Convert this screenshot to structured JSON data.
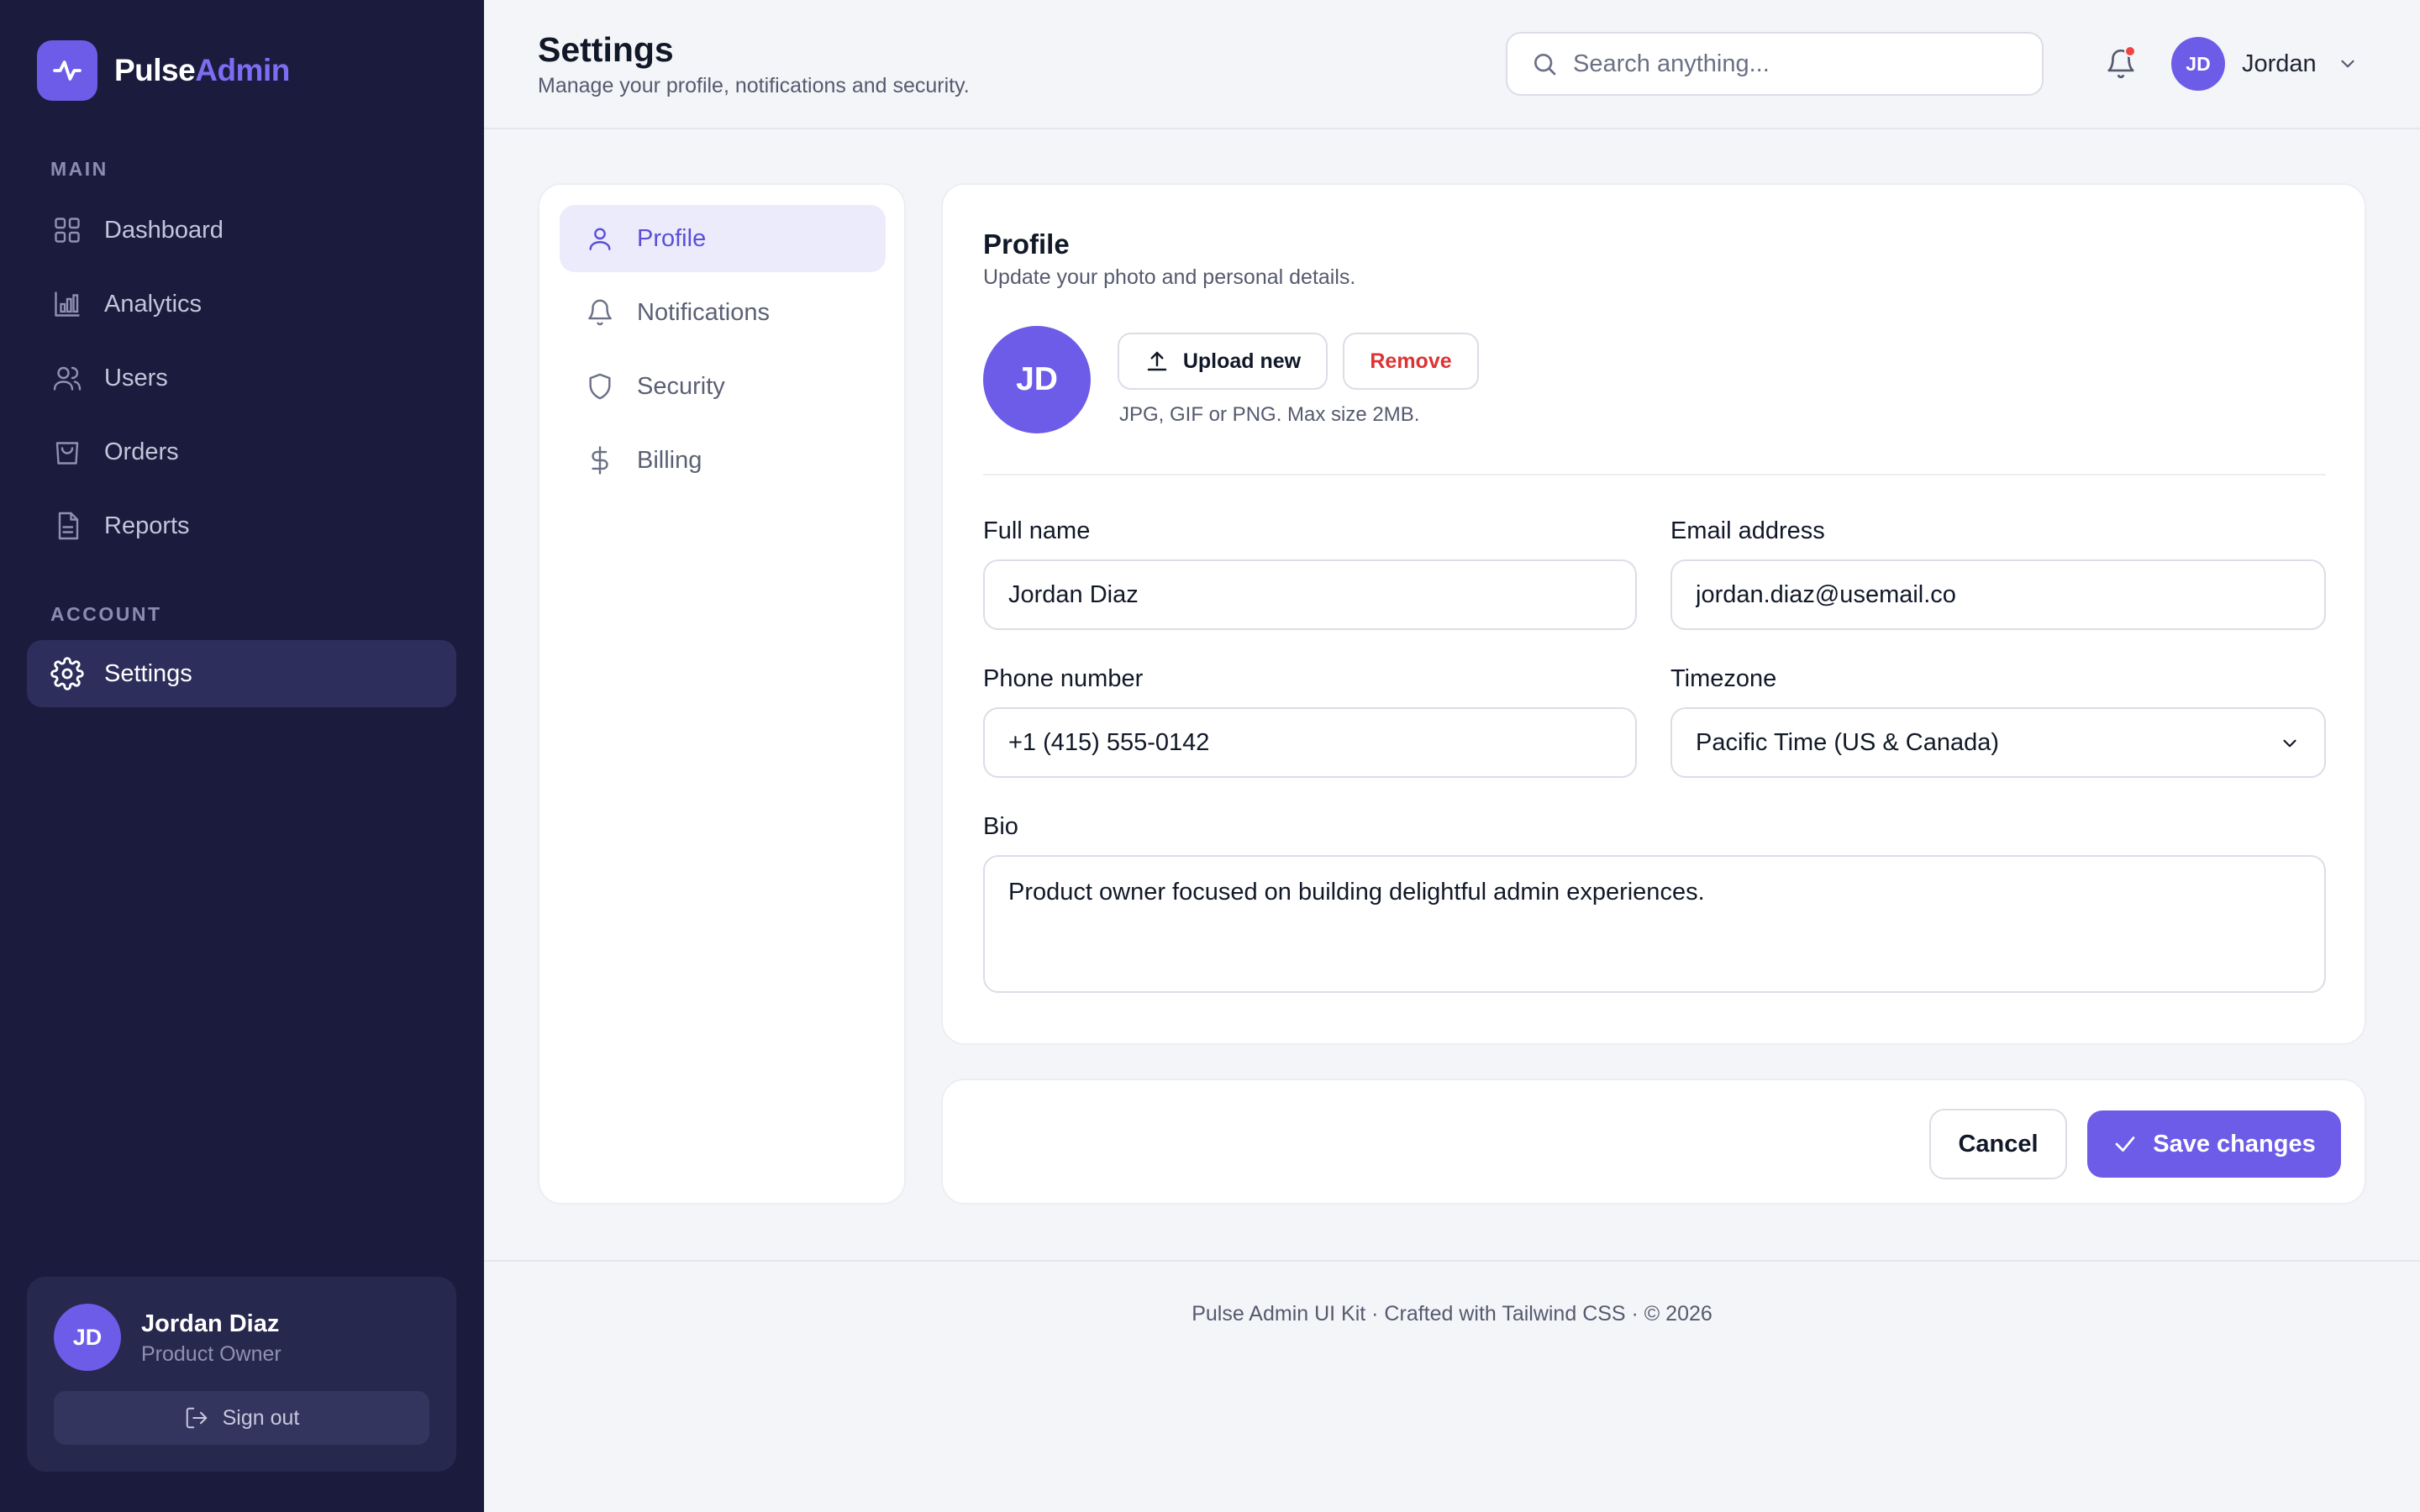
{
  "app": {
    "name_part1": "Pulse",
    "name_part2": "Admin"
  },
  "sidebar": {
    "sections": [
      "MAIN",
      "ACCOUNT"
    ],
    "items": [
      {
        "label": "Dashboard",
        "icon": "grid-icon"
      },
      {
        "label": "Analytics",
        "icon": "bar-chart-icon"
      },
      {
        "label": "Users",
        "icon": "users-icon"
      },
      {
        "label": "Orders",
        "icon": "shopping-bag-icon"
      },
      {
        "label": "Reports",
        "icon": "document-icon"
      },
      {
        "label": "Settings",
        "icon": "gear-icon",
        "active": true
      }
    ],
    "user": {
      "initials": "JD",
      "name": "Jordan Diaz",
      "role": "Product Owner",
      "signout": "Sign out"
    }
  },
  "header": {
    "title": "Settings",
    "subtitle": "Manage your profile, notifications and security.",
    "search_placeholder": "Search anything...",
    "user_initials": "JD",
    "user_name": "Jordan",
    "notification_dot_color": "#ef4444"
  },
  "settings_nav": [
    {
      "label": "Profile",
      "icon": "user-icon",
      "active": true
    },
    {
      "label": "Notifications",
      "icon": "bell-icon"
    },
    {
      "label": "Security",
      "icon": "shield-icon"
    },
    {
      "label": "Billing",
      "icon": "dollar-icon"
    }
  ],
  "profile": {
    "title": "Profile",
    "subtitle": "Update your photo and personal details.",
    "avatar_initials": "JD",
    "upload_label": "Upload new",
    "remove_label": "Remove",
    "upload_hint": "JPG, GIF or PNG. Max size 2MB.",
    "fields": {
      "full_name": {
        "label": "Full name",
        "value": "Jordan Diaz"
      },
      "email": {
        "label": "Email address",
        "value": "jordan.diaz@usemail.co"
      },
      "phone": {
        "label": "Phone number",
        "value": "+1 (415) 555-0142"
      },
      "timezone": {
        "label": "Timezone",
        "value": "Pacific Time (US & Canada)"
      },
      "bio": {
        "label": "Bio",
        "value": "Product owner focused on building delightful admin experiences."
      }
    }
  },
  "actions": {
    "cancel": "Cancel",
    "save": "Save changes"
  },
  "footer": {
    "text": "Pulse Admin UI Kit · Crafted with Tailwind CSS · © 2026"
  },
  "colors": {
    "accent": "#6d5ce8",
    "sidebar_bg": "#1b1c3d",
    "danger": "#dc3434"
  }
}
